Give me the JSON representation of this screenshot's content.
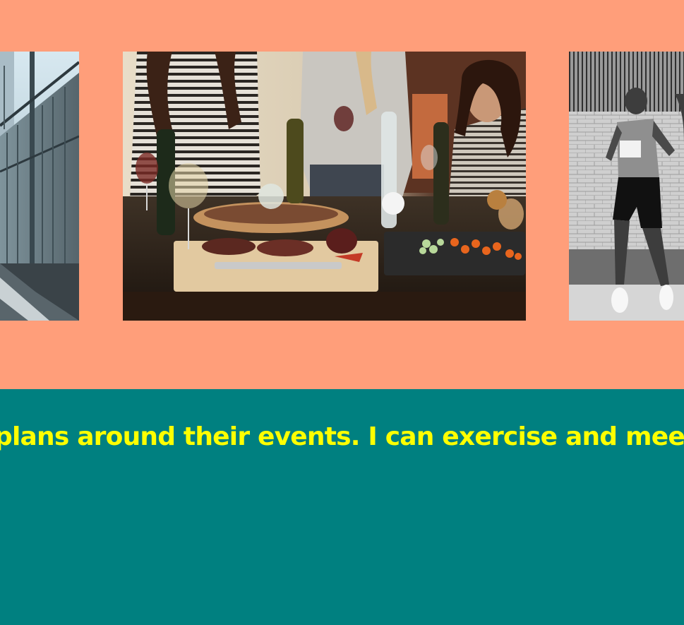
{
  "theme": {
    "gallery_background": "#FF9E7A",
    "marquee_background": "#008080",
    "marquee_text_color": "#FFFF00"
  },
  "gallery": {
    "images": [
      {
        "subject": "fence-walkway-photo"
      },
      {
        "subject": "friends-wine-dinner-photo"
      },
      {
        "subject": "marathon-runner-photo"
      }
    ]
  },
  "marquee": {
    "text": "plans around their events. I can exercise and meet"
  }
}
